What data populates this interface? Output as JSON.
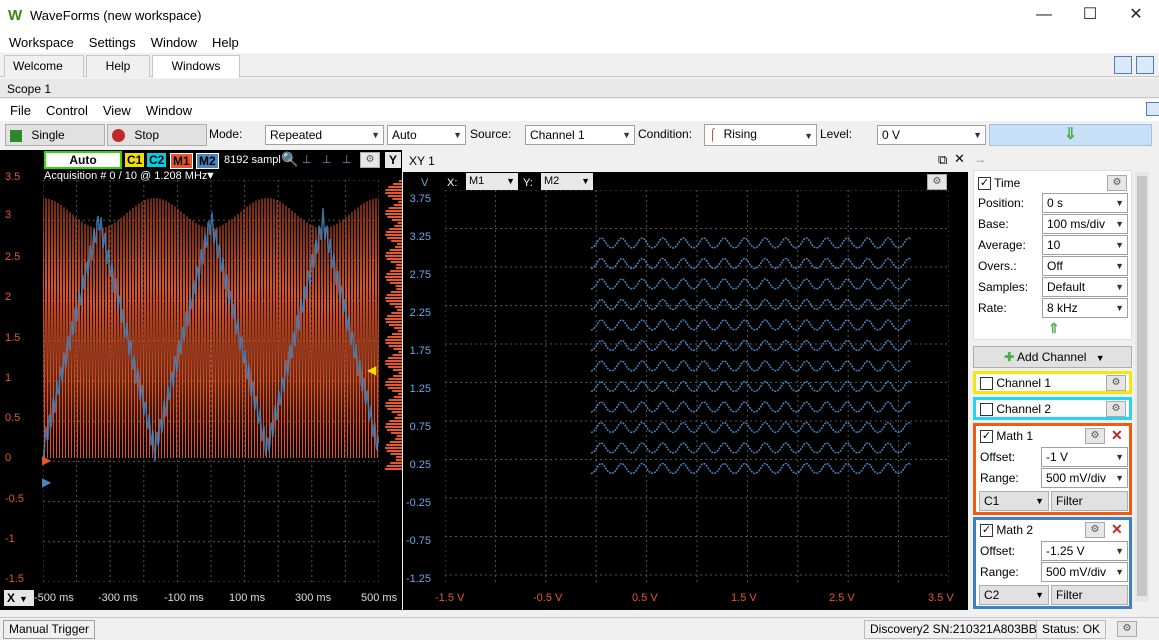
{
  "window": {
    "title": "WaveForms (new workspace)",
    "logo": "W",
    "minimize": "—",
    "maximize": "☐",
    "close": "✕"
  },
  "menu": [
    "Workspace",
    "Settings",
    "Window",
    "Help"
  ],
  "tabs": {
    "welcome": "Welcome",
    "help": "Help",
    "windows": "Windows"
  },
  "scope": {
    "title": "Scope 1",
    "menu": [
      "File",
      "Control",
      "View",
      "Window"
    ],
    "toolbar": {
      "single": "Single",
      "stop": "Stop",
      "mode_label": "Mode:",
      "mode": "Repeated",
      "auto": "Auto",
      "source_label": "Source:",
      "source": "Channel 1",
      "condition_label": "Condition:",
      "condition": "Rising",
      "level_label": "Level:",
      "level": "0 V"
    },
    "plot": {
      "auto": "Auto",
      "c1": "C1",
      "c2": "C2",
      "m1": "M1",
      "m2": "M2",
      "samples": "8192 sampl",
      "acquisition": "Acquisition # 0 / 10 @ 1.208 MHz",
      "y_axis_btn": "Y",
      "x_axis_btn": "X",
      "yticks": [
        "3.5",
        "3",
        "2.5",
        "2",
        "1.5",
        "1",
        "0.5",
        "0",
        "-0.5",
        "-1",
        "-1.5"
      ],
      "xticks": [
        "-500 ms",
        "-300 ms",
        "-100 ms",
        "100 ms",
        "300 ms",
        "500 ms"
      ]
    },
    "xy": {
      "title": "XY 1",
      "v_label": "V",
      "x_label": "X:",
      "x_src": "M1",
      "y_label": "Y:",
      "y_src": "M2",
      "yticks": [
        "3.75",
        "3.25",
        "2.75",
        "2.25",
        "1.75",
        "1.25",
        "0.75",
        "0.25",
        "-0.25",
        "-0.75",
        "-1.25"
      ],
      "xticks": [
        "-1.5 V",
        "-0.5 V",
        "0.5 V",
        "1.5 V",
        "2.5 V",
        "3.5 V"
      ]
    },
    "side": {
      "time": {
        "label": "Time",
        "position_label": "Position:",
        "position": "0 s",
        "base_label": "Base:",
        "base": "100 ms/div",
        "average_label": "Average:",
        "average": "10",
        "overs_label": "Overs.:",
        "overs": "Off",
        "samples_label": "Samples:",
        "samples": "Default",
        "rate_label": "Rate:",
        "rate": "8 kHz"
      },
      "add_channel": "Add Channel",
      "channel1": "Channel 1",
      "channel2": "Channel 2",
      "math1": {
        "label": "Math 1",
        "offset_label": "Offset:",
        "offset": "-1 V",
        "range_label": "Range:",
        "range": "500 mV/div",
        "source": "C1",
        "filter": "Filter"
      },
      "math2": {
        "label": "Math 2",
        "offset_label": "Offset:",
        "offset": "-1.25 V",
        "range_label": "Range:",
        "range": "500 mV/div",
        "source": "C2",
        "filter": "Filter"
      }
    }
  },
  "status": {
    "manual_trigger": "Manual Trigger",
    "device": "Discovery2 SN:210321A803BB",
    "status": "Status: OK"
  },
  "colors": {
    "c1": "#f0e000",
    "c2": "#00d0e0",
    "m1": "#e8572a",
    "m2": "#4a86c0",
    "ch1_border": "#f5e70a",
    "ch2_border": "#20d6f2",
    "m1_border": "#f05a12",
    "m2_border": "#3f7fc4"
  }
}
